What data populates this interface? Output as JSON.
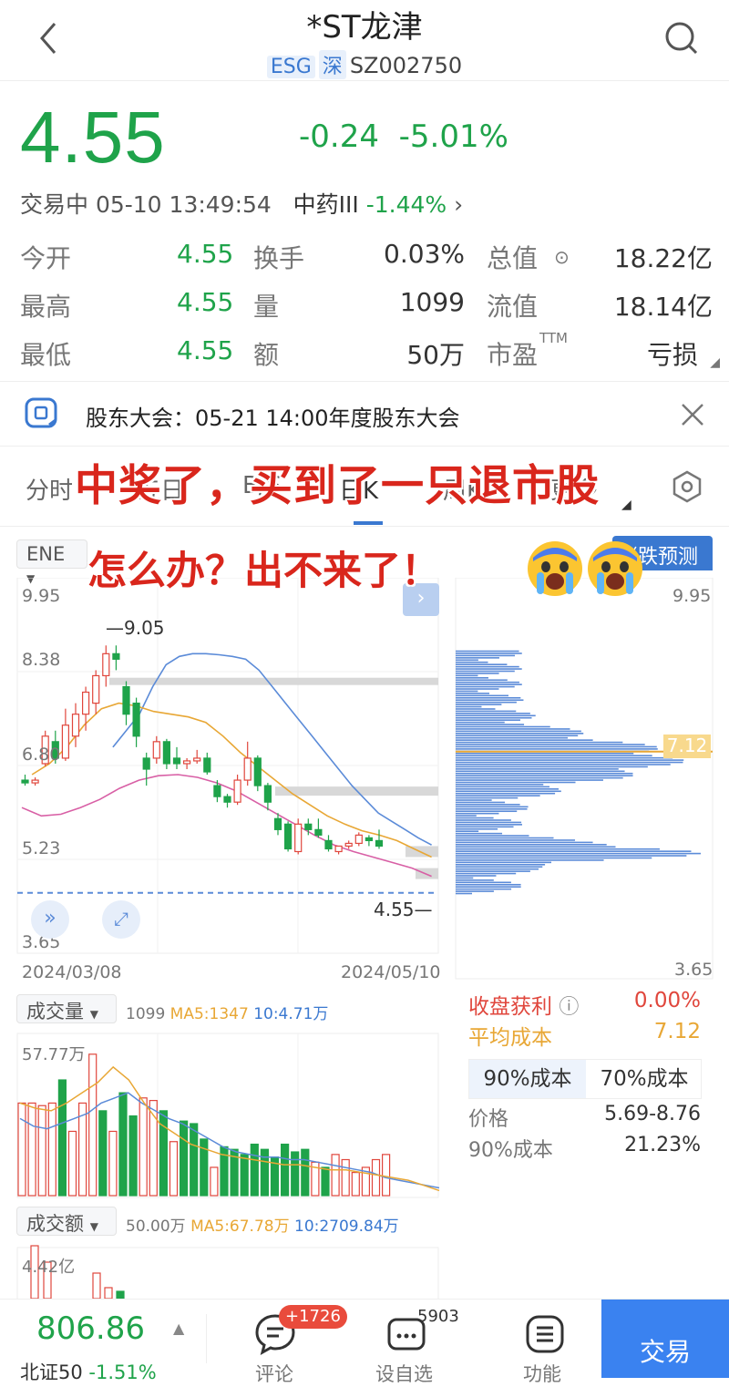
{
  "header": {
    "title": "*ST龙津",
    "tag_esg": "ESG",
    "tag_market": "深",
    "code": "SZ002750"
  },
  "quote": {
    "price": "4.55",
    "change": "-0.24",
    "change_pct": "-5.01%",
    "status": "交易中 05-10 13:49:54",
    "sector": "中药III",
    "sector_change": "-1.44%"
  },
  "stats": [
    {
      "l1": "今开",
      "v1": "4.55",
      "l2": "换手",
      "v2": "0.03%",
      "l3": "总值",
      "v3": "18.22亿"
    },
    {
      "l1": "最高",
      "v1": "4.55",
      "l2": "量",
      "v2": "1099",
      "l3": "流值",
      "v3": "18.14亿"
    },
    {
      "l1": "最低",
      "v1": "4.55",
      "l2": "额",
      "v2": "50万",
      "l3": "市盈",
      "l3_sup": "TTM",
      "v3": "亏损"
    }
  ],
  "notice": {
    "text": "股东大会：05-21 14:00年度股东大会"
  },
  "overlay": {
    "line1": "中奖了，买到了一只退市股",
    "line2": "怎么办？出不来了！"
  },
  "tabs": [
    "分时",
    "五日",
    "B/S",
    "日K",
    "周K",
    "更多"
  ],
  "indicator_bar": {
    "selector": "ENE",
    "predict_label": "涨跌预测"
  },
  "price_axis": {
    "top": "9.95",
    "l2": "8.38",
    "l3": "6.80",
    "l4": "5.23",
    "bottom": "3.65"
  },
  "price_marks": {
    "high": "9.05",
    "low": "4.55",
    "cost_line": "7.12"
  },
  "dates": {
    "start": "2024/03/08",
    "end": "2024/05/10"
  },
  "chip": {
    "right_top": "9.95",
    "right_bottom": "3.65",
    "profit_label": "收盘获利",
    "profit_value": "0.00%",
    "avg_cost_label": "平均成本",
    "avg_cost_value": "7.12",
    "tab90": "90%成本",
    "tab70": "70%成本",
    "price_label": "价格",
    "price_value": "5.69-8.76",
    "cost90_label": "90%成本",
    "cost90_value": "21.23%"
  },
  "volume": {
    "selector": "成交量",
    "value": "1099",
    "ma5": "MA5:1347",
    "ma10": "10:4.71万",
    "axis_top": "57.77万"
  },
  "amount": {
    "selector": "成交额",
    "value": "50.00万",
    "ma5": "MA5:67.78万",
    "ma10": "10:2709.84万",
    "axis_top": "4.42亿"
  },
  "bottom": {
    "index_value": "806.86",
    "index_name": "北证50",
    "index_change": "-1.51%",
    "comments_label": "评论",
    "comments_badge": "+1726",
    "watch_label": "设自选",
    "watch_count": "5903",
    "func_label": "功能",
    "trade_label": "交易"
  },
  "colors": {
    "down": "#1fa34a",
    "up": "#e0463c",
    "accent": "#3a78d0",
    "ma5": "#e8a735",
    "ma10": "#5b8bd8",
    "ma20": "#d85fa5"
  },
  "chart_data": [
    {
      "type": "candlestick",
      "title": "",
      "xlabel": "",
      "ylabel": "",
      "ylim": [
        3.65,
        9.95
      ],
      "x_range": [
        "2024/03/08",
        "2024/05/10"
      ],
      "ohlc": [
        [
          6.6,
          6.7,
          6.5,
          6.55
        ],
        [
          6.55,
          6.65,
          6.5,
          6.6
        ],
        [
          6.9,
          7.5,
          6.85,
          7.4
        ],
        [
          7.3,
          7.5,
          6.9,
          7.0
        ],
        [
          7.0,
          7.9,
          6.95,
          7.6
        ],
        [
          7.4,
          8.0,
          7.2,
          7.8
        ],
        [
          7.8,
          8.3,
          7.5,
          8.2
        ],
        [
          8.0,
          8.6,
          7.8,
          8.5
        ],
        [
          8.5,
          9.05,
          8.3,
          8.9
        ],
        [
          8.9,
          9.05,
          8.6,
          8.8
        ],
        [
          8.3,
          8.4,
          7.6,
          7.8
        ],
        [
          8.0,
          8.1,
          7.2,
          7.4
        ],
        [
          7.0,
          7.1,
          6.5,
          6.8
        ],
        [
          7.0,
          7.4,
          6.9,
          7.3
        ],
        [
          7.3,
          7.35,
          6.8,
          6.9
        ],
        [
          7.0,
          7.2,
          6.8,
          6.9
        ],
        [
          6.9,
          7.0,
          6.8,
          6.95
        ],
        [
          6.95,
          7.15,
          6.9,
          7.0
        ],
        [
          7.0,
          7.1,
          6.7,
          6.75
        ],
        [
          6.5,
          6.6,
          6.2,
          6.3
        ],
        [
          6.3,
          6.35,
          6.1,
          6.2
        ],
        [
          6.2,
          6.7,
          6.15,
          6.6
        ],
        [
          6.6,
          7.3,
          6.5,
          7.0
        ],
        [
          7.0,
          7.05,
          6.4,
          6.5
        ],
        [
          6.5,
          6.55,
          6.05,
          6.2
        ],
        [
          5.9,
          6.0,
          5.6,
          5.7
        ],
        [
          5.8,
          5.85,
          5.3,
          5.35
        ],
        [
          5.3,
          5.9,
          5.25,
          5.8
        ],
        [
          5.8,
          5.9,
          5.6,
          5.7
        ],
        [
          5.7,
          5.9,
          5.55,
          5.6
        ],
        [
          5.5,
          5.6,
          5.3,
          5.35
        ],
        [
          5.3,
          5.4,
          5.25,
          5.4
        ],
        [
          5.4,
          5.5,
          5.35,
          5.45
        ],
        [
          5.45,
          5.65,
          5.4,
          5.6
        ],
        [
          5.55,
          5.6,
          5.4,
          5.5
        ],
        [
          5.5,
          5.7,
          5.35,
          5.4
        ]
      ],
      "series": [
        {
          "name": "",
          "color": "#5b8bd8",
          "values": [
            7.2,
            7.5,
            7.8,
            8.3,
            8.7,
            8.85,
            8.9,
            8.9,
            8.88,
            8.85,
            8.8,
            8.6,
            8.3,
            8.0,
            7.7,
            7.4,
            7.1,
            6.8,
            6.5,
            6.25,
            6.0,
            5.85,
            5.7,
            5.55,
            5.42
          ]
        },
        {
          "name": "",
          "color": "#e8a735",
          "values": [
            6.7,
            6.9,
            7.2,
            7.6,
            7.9,
            8.0,
            7.95,
            7.85,
            7.8,
            7.75,
            7.65,
            7.4,
            7.1,
            6.85,
            6.6,
            6.35,
            6.15,
            5.95,
            5.8,
            5.68,
            5.6,
            5.5,
            5.35,
            5.2
          ]
        },
        {
          "name": "",
          "color": "#d85fa5",
          "values": [
            6.1,
            5.95,
            5.98,
            6.1,
            6.25,
            6.45,
            6.6,
            6.68,
            6.7,
            6.65,
            6.55,
            6.4,
            6.2,
            6.0,
            5.8,
            5.6,
            5.42,
            5.3,
            5.2,
            5.1,
            5.0,
            4.85
          ]
        }
      ]
    },
    {
      "type": "bar",
      "title": "成交量",
      "ylim": [
        0,
        57.77
      ],
      "values": [
        36,
        36,
        35,
        36,
        45,
        25,
        36,
        55,
        33,
        25,
        40,
        31,
        38,
        37,
        33,
        21,
        29,
        28,
        22,
        11,
        19,
        18,
        16,
        20,
        18,
        15,
        20,
        17,
        18,
        13,
        11,
        16,
        14,
        9,
        11,
        14,
        16
      ],
      "dir": [
        1,
        1,
        1,
        1,
        0,
        1,
        1,
        1,
        0,
        1,
        0,
        0,
        1,
        1,
        0,
        1,
        0,
        0,
        0,
        1,
        0,
        0,
        0,
        0,
        0,
        0,
        0,
        0,
        0,
        1,
        0,
        1,
        1,
        1,
        1,
        1,
        1
      ]
    },
    {
      "type": "chip_distribution",
      "title": "",
      "ylim": [
        3.65,
        9.95
      ],
      "avg_cost": 7.12
    }
  ]
}
